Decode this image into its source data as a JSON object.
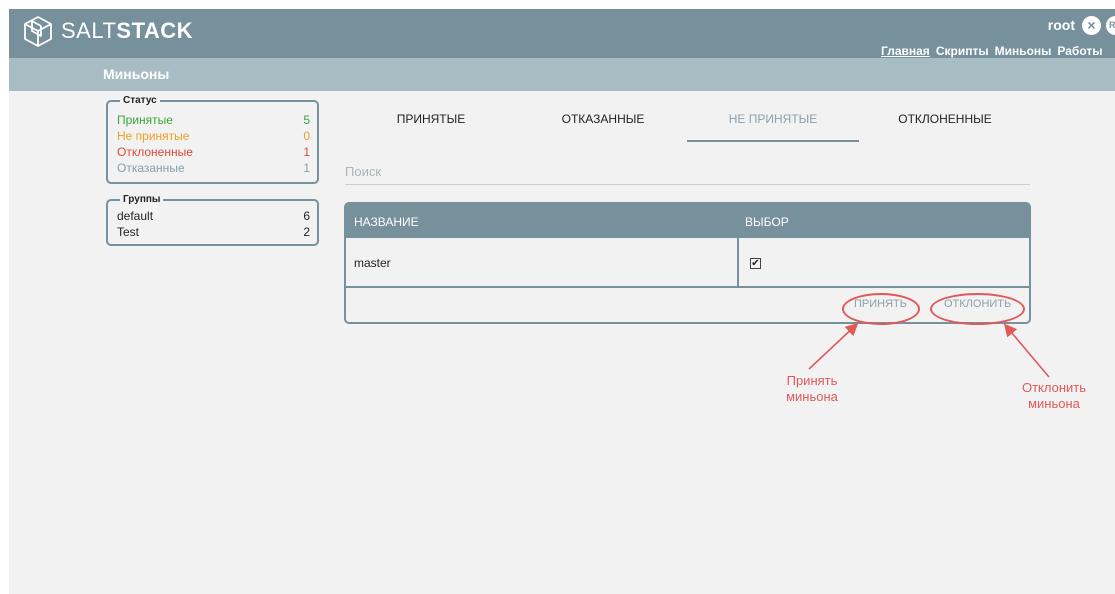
{
  "header": {
    "logo_light": "SALT",
    "logo_bold": "STACK",
    "user": "root",
    "logout_icon": "×",
    "lang": "RU",
    "nav": [
      "Главная",
      "Скрипты",
      "Миньоны",
      "Работы"
    ]
  },
  "page_title": "Миньоны",
  "status": {
    "title": "Статус",
    "items": [
      {
        "label": "Принятые",
        "count": "5",
        "color": "#3aa63a"
      },
      {
        "label": "Не принятые",
        "count": "0",
        "color": "#f0a020"
      },
      {
        "label": "Отклоненные",
        "count": "1",
        "color": "#e0483c"
      },
      {
        "label": "Отказанные",
        "count": "1",
        "color": "#8c9da6"
      }
    ]
  },
  "groups": {
    "title": "Группы",
    "items": [
      {
        "label": "default",
        "count": "6"
      },
      {
        "label": "Test",
        "count": "2"
      }
    ]
  },
  "tabs": [
    "ПРИНЯТЫЕ",
    "ОТКАЗАННЫЕ",
    "НЕ ПРИНЯТЫЕ",
    "ОТКЛОНЕННЫЕ"
  ],
  "active_tab": "НЕ ПРИНЯТЫЕ",
  "search": {
    "placeholder": "Поиск"
  },
  "table": {
    "columns": [
      "НАЗВАНИЕ",
      "ВЫБОР"
    ],
    "rows": [
      {
        "name": "master",
        "selected": true
      }
    ]
  },
  "actions": {
    "accept": "ПРИНЯТЬ",
    "reject": "ОТКЛОНИТЬ"
  },
  "annotations": {
    "accept": [
      "Принять",
      "миньона"
    ],
    "reject": [
      "Отклонить",
      "миньона"
    ]
  },
  "colors": {
    "header": "#76909c",
    "subheader": "#a8bcc4",
    "annotation": "#e05a5a"
  }
}
